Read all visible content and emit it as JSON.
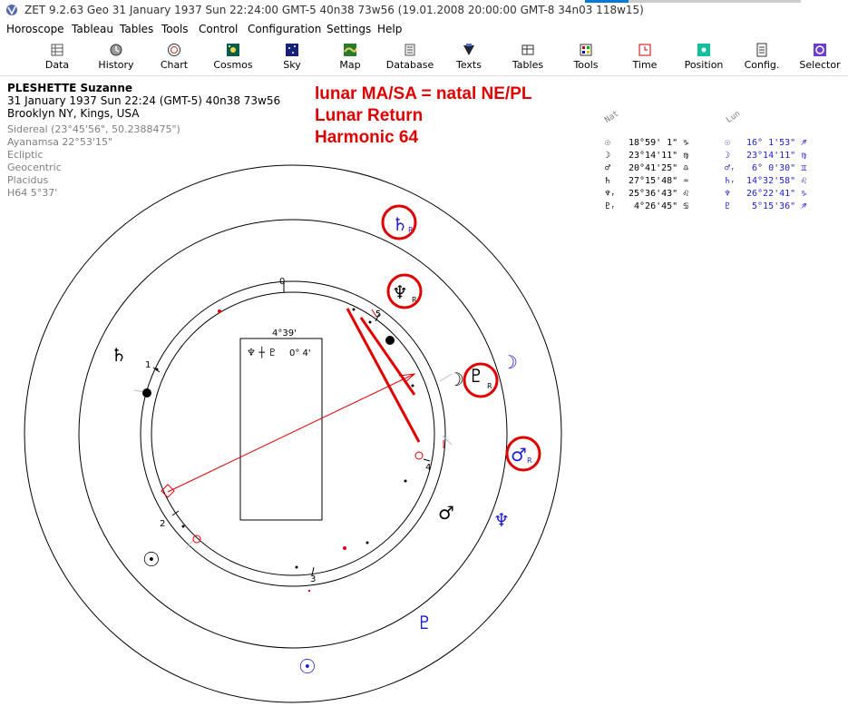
{
  "window": {
    "title": "ZET 9.2.63 Geo   31 January 1937  Sun  22:24:00 GMT-5 40n38  73w56   (19.01.2008  20:00:00 GMT-8 34n03 118w15)"
  },
  "menu": [
    {
      "label": "Horoscope"
    },
    {
      "label": "Tableau"
    },
    {
      "label": "Tables"
    },
    {
      "label": "Tools"
    },
    {
      "label": "Control"
    },
    {
      "label": "Configuration"
    },
    {
      "label": "Settings"
    },
    {
      "label": "Help"
    }
  ],
  "toolbar": [
    {
      "label": "Data",
      "icon": "data-icon"
    },
    {
      "label": "History",
      "icon": "history-icon"
    },
    {
      "label": "Chart",
      "icon": "chart-icon"
    },
    {
      "label": "Cosmos",
      "icon": "cosmos-icon"
    },
    {
      "label": "Sky",
      "icon": "sky-icon"
    },
    {
      "label": "Map",
      "icon": "map-icon"
    },
    {
      "label": "Database",
      "icon": "database-icon"
    },
    {
      "label": "Texts",
      "icon": "texts-icon"
    },
    {
      "label": "Tables",
      "icon": "tables-icon"
    },
    {
      "label": "Tools",
      "icon": "tools-icon"
    },
    {
      "label": "Time",
      "icon": "time-icon"
    },
    {
      "label": "Position",
      "icon": "position-icon"
    },
    {
      "label": "Config.",
      "icon": "config-icon"
    },
    {
      "label": "Selector",
      "icon": "selector-icon"
    }
  ],
  "info": {
    "name": "PLESHETTE Suzanne",
    "datetime": "31 January 1937  Sun  22:24 (GMT-5) 40n38  73w56",
    "place": "Brooklyn NY, Kings, USA",
    "settings": [
      "Sidereal (23°45'56\", 50.2388475\")",
      "Ayanamsa 22°53'15\"",
      "Ecliptic",
      "Geocentric",
      "Placidus",
      "H64   5°37'"
    ]
  },
  "annotation": {
    "line1": "lunar MA/SA = natal NE/PL",
    "line2": "Lunar Return",
    "line3": "Harmonic 64"
  },
  "positions": {
    "nat_header": "Nat",
    "lun_header": "Lun",
    "nat": [
      {
        "glyph": "☉",
        "value": "18°59' 1\" ♑"
      },
      {
        "glyph": "☽",
        "value": "23°14'11\" ♍"
      },
      {
        "glyph": "♂",
        "value": "20°41'25\" ♎"
      },
      {
        "glyph": "♄",
        "value": "27°15'48\" ♒"
      },
      {
        "glyph": "♆ᵣ",
        "value": "25°36'43\" ♌"
      },
      {
        "glyph": "♇ᵣ",
        "value": " 4°26'45\" ♋"
      }
    ],
    "lun": [
      {
        "glyph": "☉",
        "value": "16° 1'53\" ♐"
      },
      {
        "glyph": "☽",
        "value": "23°14'11\" ♍"
      },
      {
        "glyph": "♂ᵣ",
        "value": " 6° 0'30\" ♊"
      },
      {
        "glyph": "♄ᵣ",
        "value": "14°32'58\" ♌"
      },
      {
        "glyph": "♆",
        "value": "26°22'41\" ♑"
      },
      {
        "glyph": "♇",
        "value": " 5°15'36\" ♐"
      }
    ]
  },
  "chart": {
    "midpoint_box": {
      "value": "4°39'",
      "formula": "♆ ┼ ♇",
      "orb": "0° 4'"
    },
    "house_numbers": [
      "0",
      "1",
      "2",
      "3",
      "4",
      "5"
    ],
    "natal_glyphs": {
      "sun": "☉",
      "mars": "♂",
      "saturn": "♄",
      "moon": "☽",
      "neptune": "♆",
      "pluto": "♇",
      "retro": "R"
    },
    "lunar_glyphs": {
      "sun": "☉",
      "pluto": "♇",
      "neptune": "♆",
      "moon": "☽",
      "mars": "♂",
      "saturn": "♄",
      "retro": "R"
    },
    "colors": {
      "highlight": "#e00000",
      "lunar": "#1d1dcf",
      "natal": "#000000"
    }
  }
}
